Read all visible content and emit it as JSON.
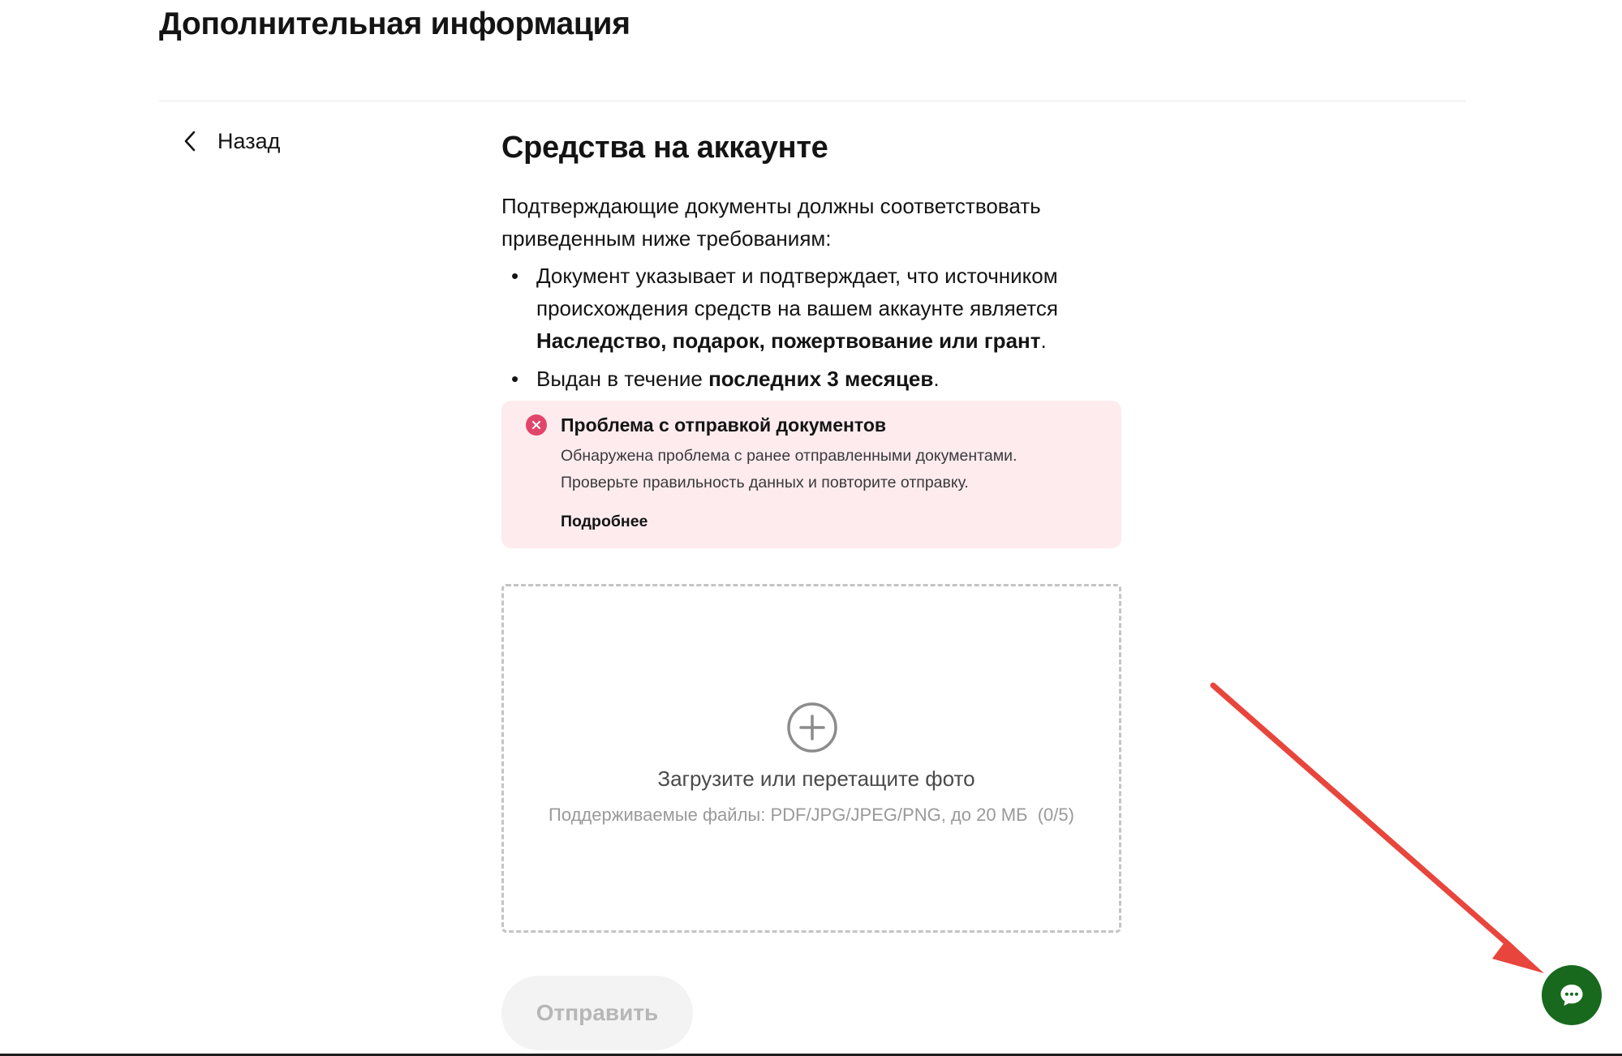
{
  "page": {
    "heading": "Дополнительная информация"
  },
  "nav": {
    "back_label": "Назад",
    "back_icon": "chevron-left-icon"
  },
  "section": {
    "title": "Средства на аккаунте",
    "intro": "Подтверждающие документы должны соответствовать приведенным ниже требованиям:",
    "requirements": [
      {
        "bullet": "•",
        "text_before": "Документ указывает и подтверждает, что источником происхождения средств на вашем аккаунте является ",
        "bold": "Наследство, подарок, пожертвование или грант",
        "text_after": "."
      },
      {
        "bullet": "•",
        "text_before": "Выдан в течение ",
        "bold": "последних 3 месяцев",
        "text_after": "."
      }
    ]
  },
  "alert": {
    "icon": "error-x-circle-icon",
    "title": "Проблема с отправкой документов",
    "body_line1": "Обнаружена проблема с ранее отправленными документами.",
    "body_line2": "Проверьте правильность данных и повторите отправку.",
    "link_label": "Подробнее",
    "icon_color": "#e2456a",
    "background_color": "#fdebee"
  },
  "upload": {
    "icon": "plus-circle-icon",
    "title": "Загрузите или перетащите фото",
    "hint": "Поддерживаемые файлы: PDF/JPG/JPEG/PNG, до 20 МБ",
    "count": "(0/5)"
  },
  "form": {
    "submit_label": "Отправить",
    "submit_disabled": true
  },
  "chat": {
    "icon": "chat-bubble-icon",
    "color": "#18691e"
  },
  "annotation": {
    "arrow_color": "#e8453c"
  }
}
